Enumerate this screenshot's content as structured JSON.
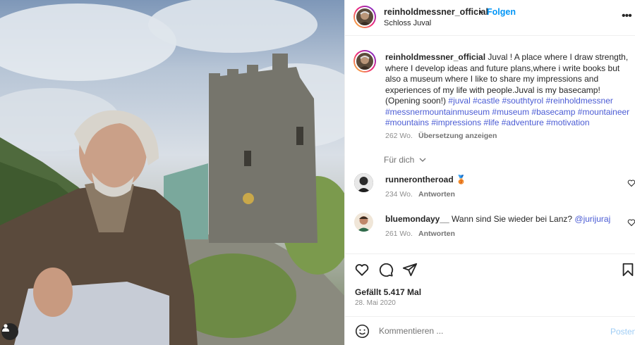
{
  "post": {
    "username": "reinholdmessner_official",
    "separator": "•",
    "follow_label": "Folgen",
    "location": "Schloss Juval",
    "more_icon": "more-horizontal-icon"
  },
  "caption": {
    "username": "reinholdmessner_official",
    "text": "Juval ! A place where I draw strength, where I develop ideas and future plans,where i write books but also a museum where I like to share my impressions and experiences of my life with people.Juval is my basecamp!(Opening soon!)",
    "hashtags": "#juval #castle #southtyrol #reinholdmessner #messnermountainmuseum #museum #basecamp #mountaineer #mountains #impressions #life #adventure #motivation",
    "age": "262 Wo.",
    "translate_label": "Übersetzung anzeigen"
  },
  "for_you": {
    "label": "Für dich",
    "icon": "chevron-down-icon"
  },
  "comments": [
    {
      "username": "runnerontheroad",
      "text": "🥉",
      "age": "234 Wo.",
      "reply_label": "Antworten"
    },
    {
      "username": "bluemondayy__",
      "text": "Wann sind Sie wieder bei Lanz?",
      "mention": "@jurijuraj",
      "age": "261 Wo.",
      "reply_label": "Antworten"
    }
  ],
  "actions": {
    "likes": "Gefällt 5.417 Mal",
    "date": "28. Mai 2020"
  },
  "comment_box": {
    "placeholder": "Kommentieren ...",
    "post_label": "Posten"
  },
  "colors": {
    "link_blue": "#0095f6",
    "hashtag_blue": "#4a5bd4",
    "post_disabled": "#9fcdf5"
  }
}
